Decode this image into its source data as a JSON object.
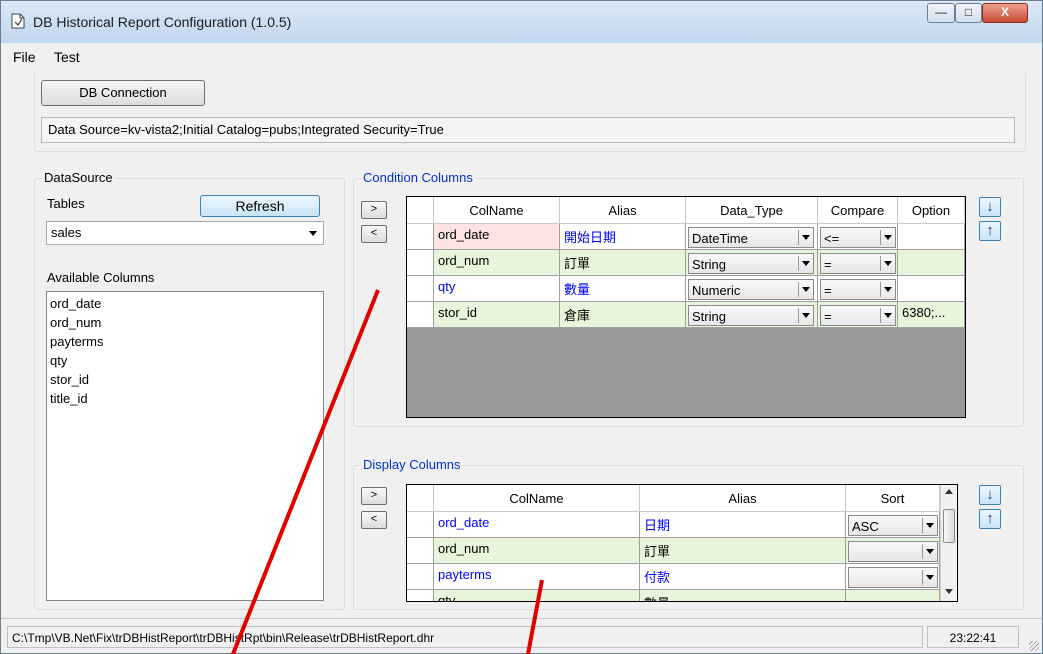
{
  "window": {
    "title": "DB Historical Report Configuration (1.0.5)",
    "controls": [
      "minimize-icon",
      "maximize-icon",
      "close-icon"
    ]
  },
  "menu": {
    "items": [
      "File",
      "Test"
    ]
  },
  "connection": {
    "button_label": "DB Connection",
    "connection_string": "Data Source=kv-vista2;Initial Catalog=pubs;Integrated Security=True"
  },
  "datasource": {
    "group_label": "DataSource",
    "tables_label": "Tables",
    "refresh_label": "Refresh",
    "selected_table": "sales",
    "available_columns_label": "Available Columns",
    "available_columns": [
      "ord_date",
      "ord_num",
      "payterms",
      "qty",
      "stor_id",
      "title_id"
    ]
  },
  "condition": {
    "group_label": "Condition Columns",
    "add_label": ">",
    "remove_label": "<",
    "headers": [
      "ColName",
      "Alias",
      "Data_Type",
      "Compare",
      "Option"
    ],
    "rows": [
      {
        "colname": "ord_date",
        "alias": "開始日期",
        "data_type": "DateTime",
        "compare": "<=",
        "option": ""
      },
      {
        "colname": "ord_num",
        "alias": "訂單",
        "data_type": "String",
        "compare": "=",
        "option": ""
      },
      {
        "colname": "qty",
        "alias": "數量",
        "data_type": "Numeric",
        "compare": "=",
        "option": ""
      },
      {
        "colname": "stor_id",
        "alias": "倉庫",
        "data_type": "String",
        "compare": "=",
        "option": "6380;..."
      }
    ],
    "move_down_label": "↓",
    "move_up_label": "↑"
  },
  "display": {
    "group_label": "Display Columns",
    "add_label": ">",
    "remove_label": "<",
    "headers": [
      "ColName",
      "Alias",
      "Sort"
    ],
    "rows": [
      {
        "colname": "ord_date",
        "alias": "日期",
        "sort": "ASC"
      },
      {
        "colname": "ord_num",
        "alias": "訂單",
        "sort": ""
      },
      {
        "colname": "payterms",
        "alias": "付款",
        "sort": ""
      },
      {
        "colname": "qty",
        "alias": "數量",
        "sort": ""
      }
    ],
    "move_down_label": "↓",
    "move_up_label": "↑"
  },
  "status": {
    "path": "C:\\Tmp\\VB.Net\\Fix\\trDBHistReport\\trDBHistRpt\\bin\\Release\\trDBHistReport.dhr",
    "time": "23:22:41"
  },
  "colors": {
    "alias_blue": "#0000ff",
    "row_green": "#e6f5dc",
    "row_pink": "#fde4e0",
    "legend_blue": "#0033cc",
    "grid_empty": "#9a9a9a"
  }
}
